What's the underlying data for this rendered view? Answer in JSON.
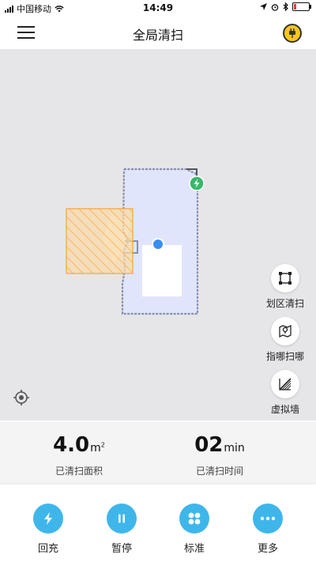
{
  "status_bar": {
    "carrier": "中国移动",
    "time": "14:49"
  },
  "header": {
    "title": "全局清扫",
    "menu_icon": "menu-icon",
    "plug_icon": "plug-icon"
  },
  "map": {
    "dock_icon": "lightning-icon",
    "robot_icon": "robot-dot-icon"
  },
  "side_tools": [
    {
      "label": "划区清扫",
      "icon": "zone-clean-icon"
    },
    {
      "label": "指哪扫哪",
      "icon": "spot-clean-icon"
    },
    {
      "label": "虚拟墙",
      "icon": "virtual-wall-icon"
    }
  ],
  "stats": {
    "area": {
      "value": "4.0",
      "unit": "m",
      "unit_sup": "2",
      "label": "已清扫面积"
    },
    "time": {
      "value": "02",
      "unit": "min",
      "label": "已清扫时间"
    }
  },
  "actions": [
    {
      "label": "回充",
      "icon": "recharge-icon"
    },
    {
      "label": "暂停",
      "icon": "pause-icon"
    },
    {
      "label": "标准",
      "icon": "fan-icon"
    },
    {
      "label": "更多",
      "icon": "more-icon"
    }
  ],
  "colors": {
    "accent": "#3fb6ea",
    "map_background": "#e6e6e9",
    "cleaned_area": "#e1e5fb",
    "robot": "#3b8ef0",
    "dock": "#35b96a",
    "zone": "#f6a43a",
    "plug_badge": "#f7c51e"
  }
}
